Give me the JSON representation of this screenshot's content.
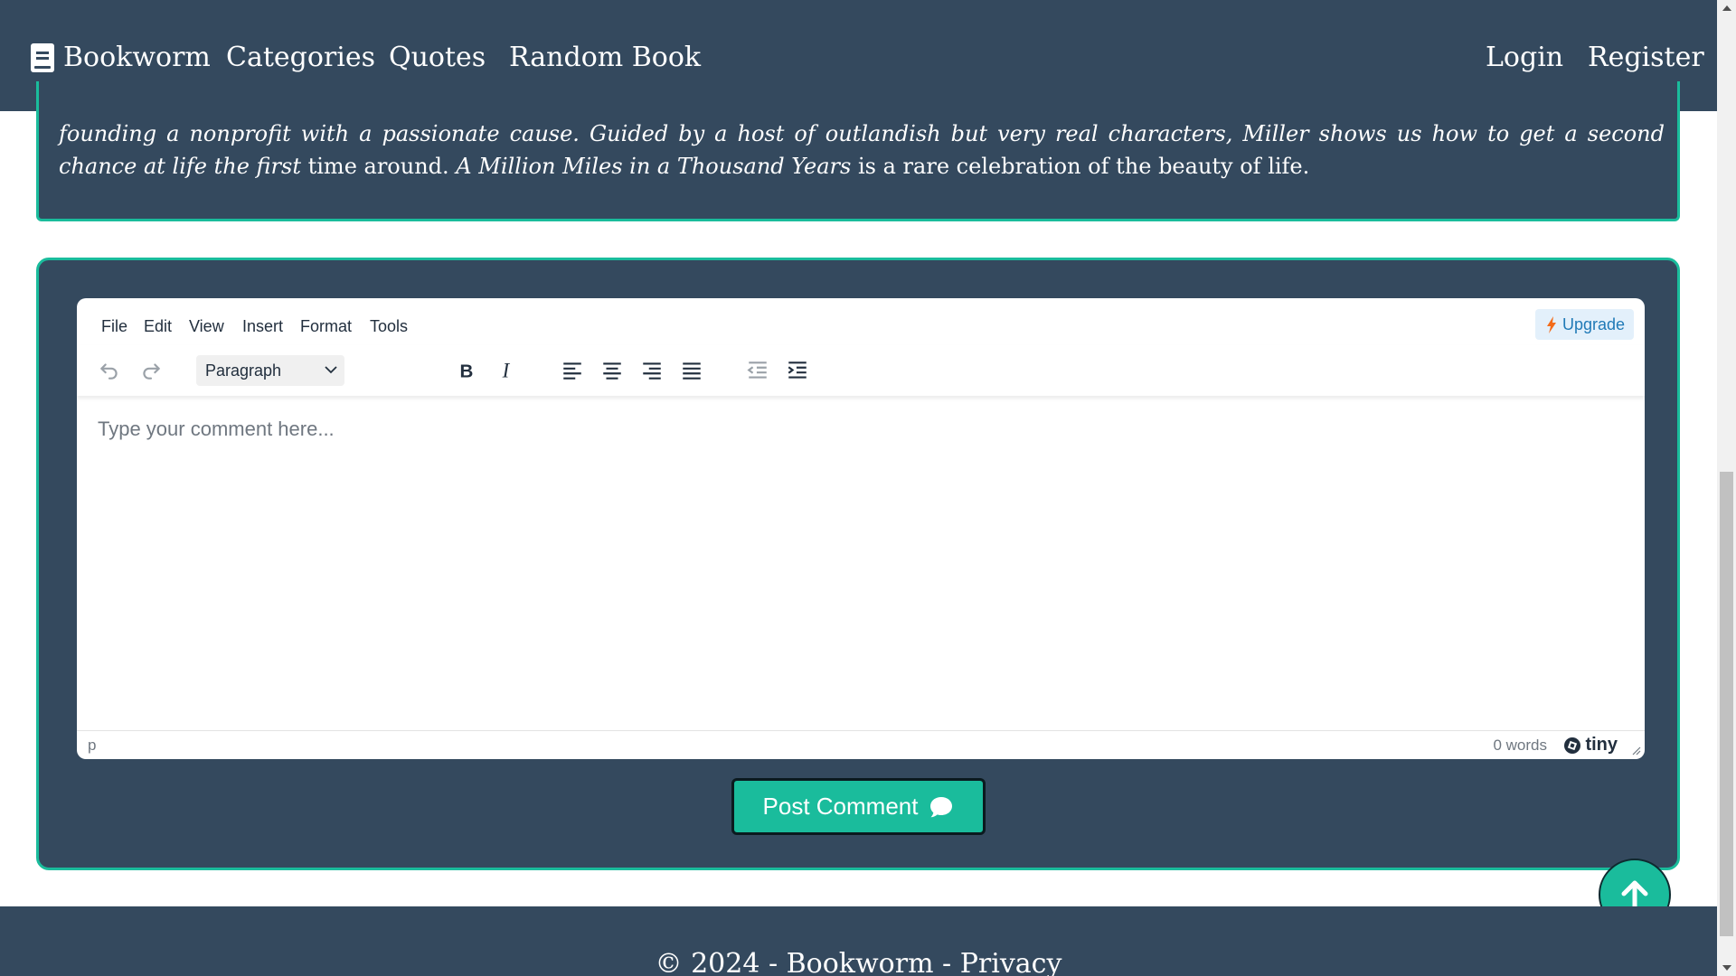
{
  "navbar": {
    "brand": "Bookworm",
    "links": [
      "Categories",
      "Quotes",
      "Random Book"
    ],
    "login": "Login",
    "register": "Register"
  },
  "description": {
    "line1": "founding a nonprofit with a passionate cause. Guided by a host of outlandish but very real characters, Miller shows us how to get a second chance at life the first",
    "line2_pre": "time around.",
    "line2_title": "A Million Miles in a Thousand Years",
    "line2_post": "is a rare celebration of the beauty of life."
  },
  "editor": {
    "menu": [
      "File",
      "Edit",
      "View",
      "Insert",
      "Format",
      "Tools"
    ],
    "upgrade": "Upgrade",
    "block_format": "Paragraph",
    "placeholder": "Type your comment here...",
    "path": "p",
    "word_count": "0 words",
    "brand": "tiny"
  },
  "post_button": "Post Comment",
  "footer": {
    "text": "© 2024 - Bookworm - Privacy"
  },
  "colors": {
    "navy": "#34495e",
    "accent": "#1abc9c",
    "upgrade_text": "#207ab7"
  },
  "icons": [
    "book-icon",
    "bolt-icon",
    "undo-icon",
    "redo-icon",
    "chevron-down-icon",
    "bold-icon",
    "italic-icon",
    "align-left-icon",
    "align-center-icon",
    "align-right-icon",
    "align-justify-icon",
    "outdent-icon",
    "indent-icon",
    "tiny-logo-icon",
    "resize-icon",
    "comment-icon",
    "arrow-up-icon"
  ]
}
